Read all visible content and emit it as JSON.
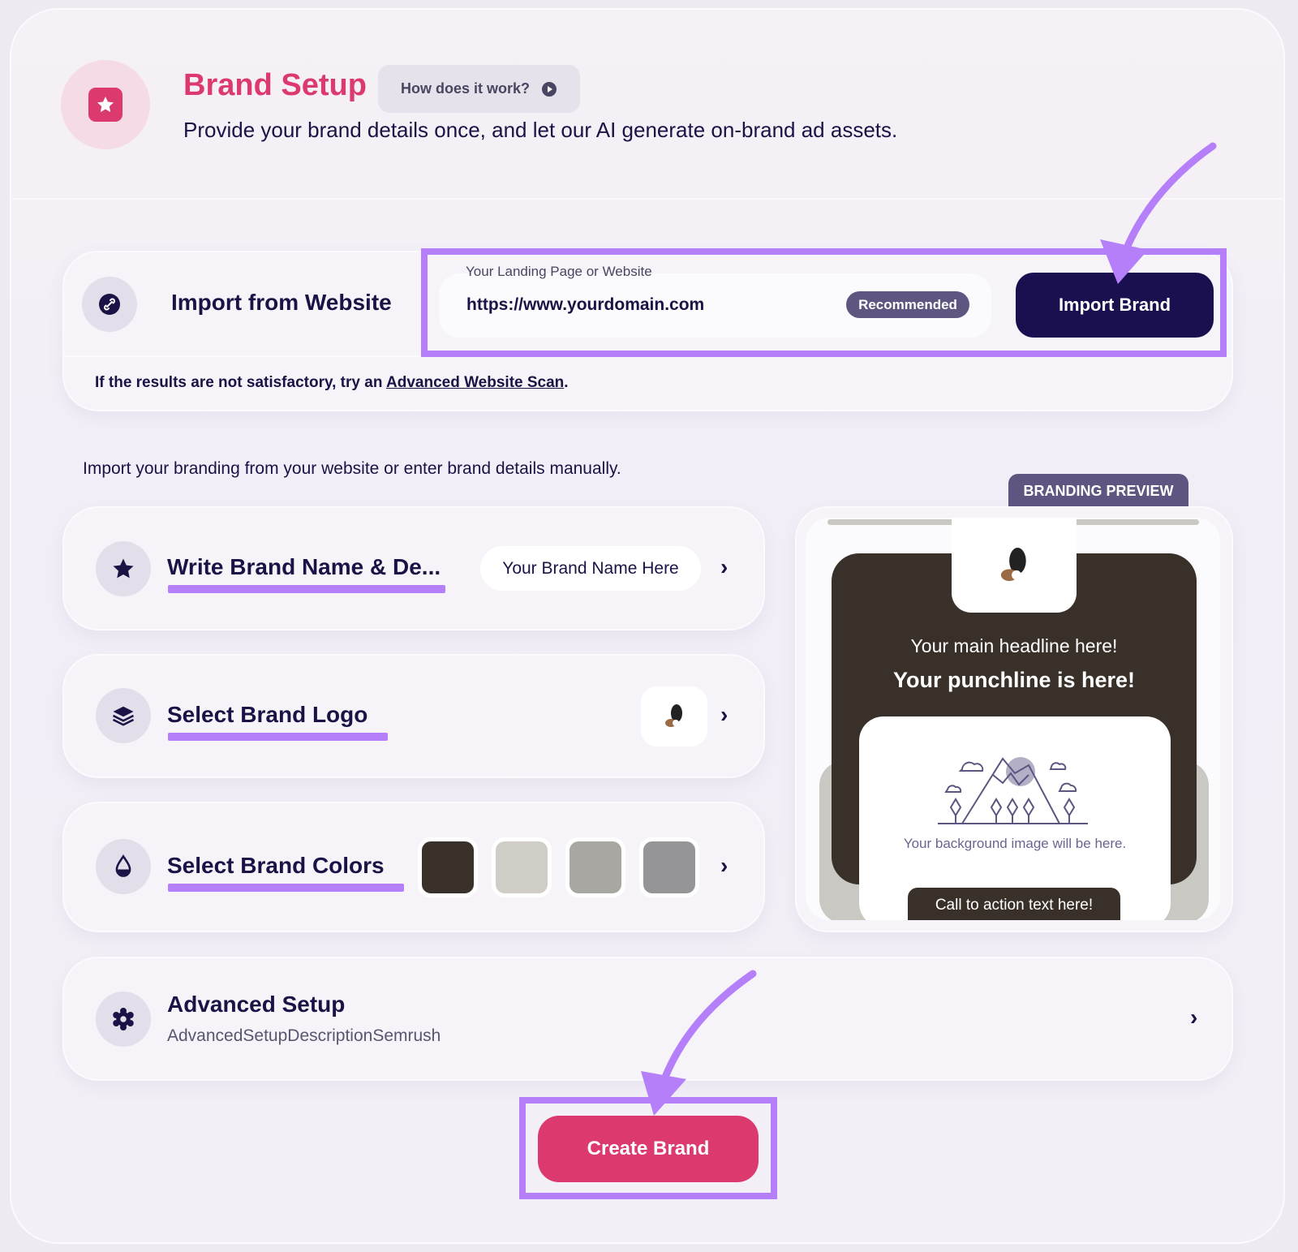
{
  "header": {
    "title": "Brand Setup",
    "how_button": "How does it work?",
    "subtitle": "Provide your brand details once, and let our AI generate on-brand ad assets."
  },
  "import": {
    "title": "Import from Website",
    "field_label": "Your Landing Page or Website",
    "field_value": "https://www.yourdomain.com",
    "badge": "Recommended",
    "button": "Import Brand",
    "note_prefix": "If the results are not satisfactory, try an ",
    "note_link": "Advanced Website Scan",
    "note_suffix": "."
  },
  "instruction": "Import your branding from your website or enter brand details manually.",
  "rows": {
    "name": {
      "title": "Write Brand Name & De...",
      "value": "Your Brand Name Here"
    },
    "logo": {
      "title": "Select Brand Logo"
    },
    "colors": {
      "title": "Select Brand Colors",
      "swatches": [
        "#3a302a",
        "#cfcdc6",
        "#a9a7a1",
        "#959497"
      ]
    },
    "advanced": {
      "title": "Advanced Setup",
      "description": "AdvancedSetupDescriptionSemrush"
    }
  },
  "preview": {
    "tab": "BRANDING PREVIEW",
    "headline": "Your main headline here!",
    "punchline": "Your punchline is here!",
    "bg_text": "Your background image will be here.",
    "cta": "Call to action text here!"
  },
  "create_button": "Create Brand",
  "colors": {
    "brand_pink": "#dc3a6e",
    "navy": "#1a1050",
    "highlight": "#b57ffa",
    "tab": "#5e5580"
  }
}
